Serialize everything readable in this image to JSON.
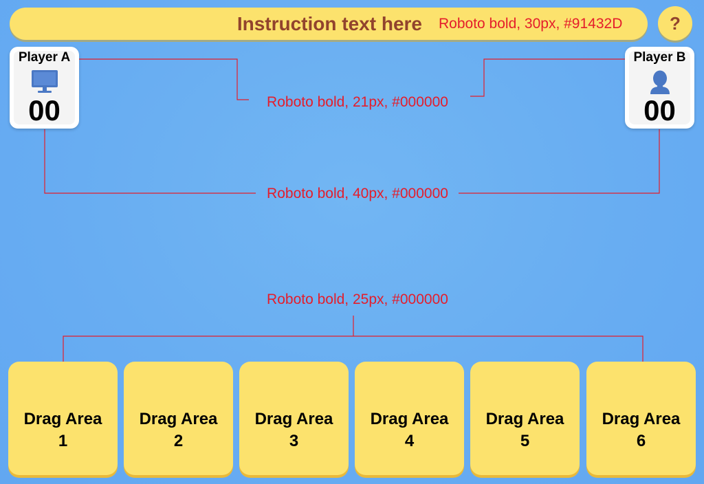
{
  "instruction": {
    "text": "Instruction text here",
    "font_note": "Roboto bold, 30px, #91432D"
  },
  "help": {
    "label": "?"
  },
  "players": {
    "a": {
      "name": "Player A",
      "score": "00",
      "icon": "monitor-icon"
    },
    "b": {
      "name": "Player B",
      "score": "00",
      "icon": "user-icon"
    }
  },
  "annotations": {
    "player_name": "Roboto bold, 21px, #000000",
    "player_score": "Roboto bold, 40px, #000000",
    "drag_label": "Roboto bold, 25px, #000000"
  },
  "drag_areas": [
    {
      "title": "Drag Area",
      "number": "1"
    },
    {
      "title": "Drag Area",
      "number": "2"
    },
    {
      "title": "Drag Area",
      "number": "3"
    },
    {
      "title": "Drag Area",
      "number": "4"
    },
    {
      "title": "Drag Area",
      "number": "5"
    },
    {
      "title": "Drag Area",
      "number": "6"
    }
  ],
  "colors": {
    "background": "#68adf2",
    "panel_yellow": "#fce26d",
    "instruction_text": "#91432d",
    "annotation_red": "#e41d2b",
    "icon_blue": "#4a78c4"
  }
}
